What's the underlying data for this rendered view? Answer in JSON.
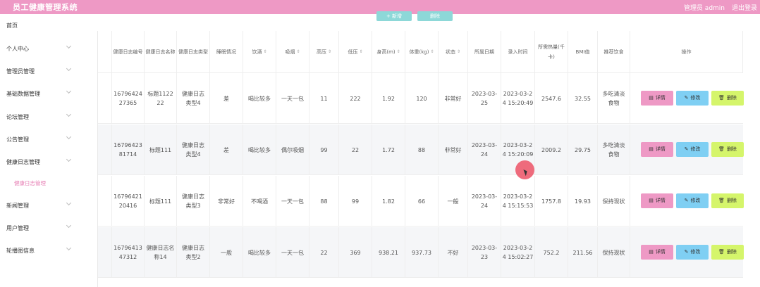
{
  "header": {
    "title": "员工健康管理系统",
    "admin": "管理员 admin",
    "logout": "退出登录"
  },
  "sidebar": {
    "items": [
      {
        "label": "首页"
      },
      {
        "label": "个人中心"
      },
      {
        "label": "管理员管理"
      },
      {
        "label": "基础数据管理"
      },
      {
        "label": "论坛管理"
      },
      {
        "label": "公告管理"
      },
      {
        "label": "健康日志管理"
      },
      {
        "label": "新闻管理"
      },
      {
        "label": "用户管理"
      },
      {
        "label": "轮播图信息"
      }
    ],
    "sub": {
      "label": "健康日志管理"
    }
  },
  "toolbar": {
    "add_label": "+ 新增",
    "delete_label": "删除"
  },
  "table": {
    "columns": [
      "健康日志编号",
      "健康日志名称",
      "健康日志类型",
      "睡眠情况",
      "饮酒",
      "吸烟",
      "高压",
      "低压",
      "身高(m)",
      "体重(kg)",
      "状态",
      "所属日期",
      "录入时间",
      "所需热量(千卡)",
      "BMI值",
      "推荐饮食",
      "操作"
    ],
    "rows": [
      {
        "id": "1679642427365",
        "name": "标题112222",
        "type": "健康日志类型4",
        "sleep": "差",
        "drink": "喝比较多",
        "smoke": "一天一包",
        "high": "11",
        "low": "222",
        "height": "1.92",
        "weight": "120",
        "status": "非常好",
        "date": "2023-03-25",
        "time": "2023-03-24 15:20:49",
        "kcal": "2547.6",
        "bmi": "32.55",
        "diet": "多吃清淡食物"
      },
      {
        "id": "1679642381714",
        "name": "标题111",
        "type": "健康日志类型4",
        "sleep": "差",
        "drink": "喝比较多",
        "smoke": "偶尔吸烟",
        "high": "99",
        "low": "22",
        "height": "1.72",
        "weight": "88",
        "status": "非常好",
        "date": "2023-03-24",
        "time": "2023-03-24 15:20:09",
        "kcal": "2009.2",
        "bmi": "29.75",
        "diet": "多吃清淡食物"
      },
      {
        "id": "1679642120416",
        "name": "标题111",
        "type": "健康日志类型3",
        "sleep": "非常好",
        "drink": "不喝酒",
        "smoke": "一天一包",
        "high": "88",
        "low": "99",
        "height": "1.82",
        "weight": "66",
        "status": "一般",
        "date": "2023-03-24",
        "time": "2023-03-24 15:15:53",
        "kcal": "1757.8",
        "bmi": "19.93",
        "diet": "保持现状"
      },
      {
        "id": "1679641347312",
        "name": "健康日志名称14",
        "type": "健康日志类型2",
        "sleep": "一般",
        "drink": "喝比较多",
        "smoke": "一天一包",
        "high": "22",
        "low": "369",
        "height": "938.21",
        "weight": "937.73",
        "status": "不好",
        "date": "2023-03-23",
        "time": "2023-03-24 15:02:27",
        "kcal": "752.2",
        "bmi": "211.56",
        "diet": "保持现状"
      }
    ],
    "actions": {
      "detail": "详情",
      "edit": "修改",
      "delete": "删除"
    }
  },
  "colors": {
    "primary": "#ee99c5",
    "edit": "#7fcff3",
    "delete": "#d5f56b",
    "accent": "#8dd8d8"
  }
}
